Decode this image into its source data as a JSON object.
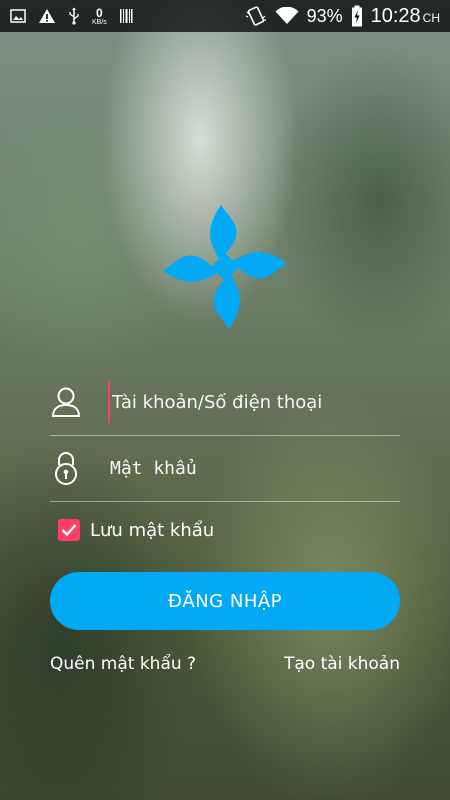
{
  "status_bar": {
    "icons_left": [
      "gallery-icon",
      "warning-icon",
      "usb-icon",
      "data-speed-icon",
      "barcode-icon"
    ],
    "data_speed_value": "0",
    "data_speed_unit": "KB/s",
    "icons_right": [
      "vibrate-icon",
      "wifi-icon",
      "battery-charging-icon"
    ],
    "battery_percent": "93%",
    "time": "10:28",
    "time_suffix": "CH"
  },
  "logo": {
    "icon": "pinwheel-logo-icon",
    "color": "#03a9f4"
  },
  "account_field": {
    "icon": "user-icon",
    "placeholder": "Tài khoản/Số điện thoại",
    "value": ""
  },
  "password_field": {
    "icon": "lock-icon",
    "placeholder": "Mật khẩu",
    "value": ""
  },
  "remember_password": {
    "label": "Lưu mật khẩu",
    "checked": true,
    "color": "#ff3d6b"
  },
  "login_button": {
    "label": "ĐĂNG NHẬP",
    "color": "#03a9f4"
  },
  "links": {
    "forgot_password": "Quên mật khẩu ?",
    "create_account": "Tạo tài khoản"
  }
}
